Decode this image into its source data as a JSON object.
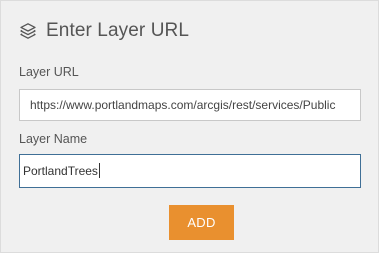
{
  "header": {
    "icon": "layers-icon",
    "title": "Enter Layer URL"
  },
  "form": {
    "layer_url": {
      "label": "Layer URL",
      "value": "https://www.portlandmaps.com/arcgis/rest/services/Public"
    },
    "layer_name": {
      "label": "Layer Name",
      "value": "PortlandTrees"
    },
    "add_label": "ADD"
  },
  "colors": {
    "panel_background": "#f0f0f0",
    "add_button": "#e9902f",
    "focused_border": "#3f6f96"
  }
}
